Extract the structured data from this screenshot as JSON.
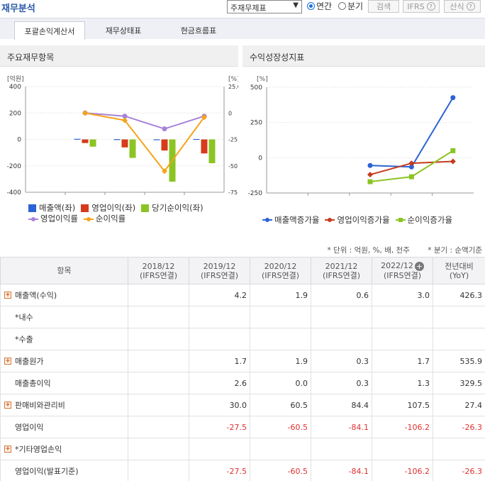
{
  "header": {
    "title": "재무분석",
    "select_value": "주재무제표",
    "period_annual": "연간",
    "period_quarter": "분기",
    "search_label": "검색",
    "ifrs_label": "IFRS",
    "formula_label": "산식"
  },
  "tabs": [
    "포괄손익계산서",
    "재무상태표",
    "현금흐름표"
  ],
  "panel_left": {
    "title": "주요재무항목",
    "legend": [
      "매출액(좌)",
      "영업이익(좌)",
      "당기순이익(좌)",
      "영업이익률",
      "순이익률"
    ]
  },
  "panel_right": {
    "title": "수익성장성지표",
    "legend": [
      "매출액증가율",
      "영업이익증가율",
      "순이익증가율"
    ]
  },
  "colors": {
    "sales": "#2b63d4",
    "op_income": "#d63b1a",
    "net_income": "#8ac523",
    "op_margin": "#a982d8",
    "net_margin": "#f5a31a",
    "op_growth": "#c53a1e"
  },
  "chart_data": [
    {
      "type": "bar",
      "categories": [
        "2018/12",
        "2019/12",
        "2020/12",
        "2021/12",
        "2022/12"
      ],
      "ylabel": "[억원]",
      "ylim": [
        -400,
        400
      ],
      "yticks": [
        "400",
        "200",
        "0",
        "-200",
        "-400"
      ],
      "y2label": "[%]",
      "y2lim": [
        -75,
        25
      ],
      "y2ticks": [
        "25.0",
        "0",
        "-25.",
        "-50.",
        "-75."
      ],
      "series": [
        {
          "name": "매출액(좌)",
          "kind": "bar",
          "axis": "left",
          "values": [
            null,
            4.2,
            1.9,
            0.6,
            3.0
          ]
        },
        {
          "name": "영업이익(좌)",
          "kind": "bar",
          "axis": "left",
          "values": [
            null,
            -27.5,
            -60.5,
            -84.1,
            -106.2
          ]
        },
        {
          "name": "당기순이익(좌)",
          "kind": "bar",
          "axis": "left",
          "values": [
            null,
            -55,
            -140,
            -320,
            -180
          ]
        },
        {
          "name": "영업이익률",
          "kind": "line",
          "axis": "right",
          "values": [
            null,
            0,
            -3,
            -15,
            -3
          ]
        },
        {
          "name": "순이익률",
          "kind": "line",
          "axis": "right",
          "values": [
            null,
            0,
            -7,
            -55,
            -4
          ]
        }
      ]
    },
    {
      "type": "line",
      "categories": [
        "2018/12",
        "2019/12",
        "2020/12",
        "2021/12",
        "2022/12"
      ],
      "ylabel": "[%]",
      "ylim": [
        -250,
        500
      ],
      "yticks": [
        "500",
        "250",
        "0",
        "-250"
      ],
      "series": [
        {
          "name": "매출액증가율",
          "values": [
            null,
            null,
            -55,
            -65,
            426.3
          ]
        },
        {
          "name": "영업이익증가율",
          "values": [
            null,
            null,
            -120,
            -39,
            -26.3
          ]
        },
        {
          "name": "순이익증가율",
          "values": [
            null,
            null,
            -170,
            -135,
            50
          ]
        }
      ]
    }
  ],
  "table": {
    "notes": [
      "* 단위 : 억원, %, 배, 천주",
      "* 분기 : 순액기준"
    ],
    "col_item": "항목",
    "columns": [
      {
        "year": "2018/12",
        "basis": "(IFRS연결)"
      },
      {
        "year": "2019/12",
        "basis": "(IFRS연결)"
      },
      {
        "year": "2020/12",
        "basis": "(IFRS연결)"
      },
      {
        "year": "2021/12",
        "basis": "(IFRS연결)"
      },
      {
        "year": "2022/12",
        "basis": "(IFRS연결)"
      }
    ],
    "yoy": {
      "label": "전년대비",
      "sub": "(YoY)"
    },
    "rows": [
      {
        "label": "매출액(수익)",
        "expand": true,
        "vals": [
          "",
          "4.2",
          "1.9",
          "0.6",
          "3.0",
          "426.3"
        ],
        "neg": false
      },
      {
        "label": "*내수",
        "expand": false,
        "vals": [
          "",
          "",
          "",
          "",
          "",
          ""
        ],
        "neg": false
      },
      {
        "label": "*수출",
        "expand": false,
        "vals": [
          "",
          "",
          "",
          "",
          "",
          ""
        ],
        "neg": false
      },
      {
        "label": "매출원가",
        "expand": true,
        "vals": [
          "",
          "1.7",
          "1.9",
          "0.3",
          "1.7",
          "535.9"
        ],
        "neg": false
      },
      {
        "label": "매출총이익",
        "expand": false,
        "vals": [
          "",
          "2.6",
          "0.0",
          "0.3",
          "1.3",
          "329.5"
        ],
        "neg": false
      },
      {
        "label": "판매비와관리비",
        "expand": true,
        "vals": [
          "",
          "30.0",
          "60.5",
          "84.4",
          "107.5",
          "27.4"
        ],
        "neg": false
      },
      {
        "label": "영업이익",
        "expand": false,
        "vals": [
          "",
          "-27.5",
          "-60.5",
          "-84.1",
          "-106.2",
          "-26.3"
        ],
        "neg": true
      },
      {
        "label": "*기타영업손익",
        "expand": true,
        "vals": [
          "",
          "",
          "",
          "",
          "",
          ""
        ],
        "neg": false
      },
      {
        "label": "영업이익(발표기준)",
        "expand": false,
        "vals": [
          "",
          "-27.5",
          "-60.5",
          "-84.1",
          "-106.2",
          "-26.3"
        ],
        "neg": true
      }
    ]
  }
}
